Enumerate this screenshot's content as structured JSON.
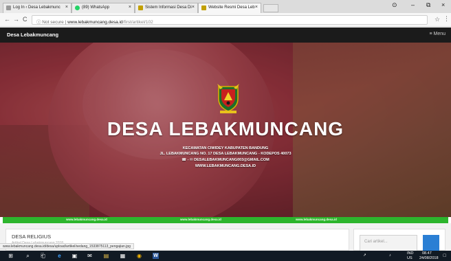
{
  "browser": {
    "tabs": [
      {
        "label": "Log In ‹ Desa Lebakmunc",
        "favicon_color": "#9a9a9a"
      },
      {
        "label": "(89) WhatsApp",
        "favicon_color": "#25d366"
      },
      {
        "label": "Sistem Informasi Desa Di",
        "favicon_color": "#c2a000"
      },
      {
        "label": "Website Resmi Desa Leb",
        "favicon_color": "#c2a000"
      }
    ],
    "close_glyph": "×",
    "window_controls": {
      "account": "⊙",
      "minimize": "–",
      "maximize": "⧉",
      "close": "×"
    },
    "nav": {
      "back": "←",
      "forward": "→",
      "reload": "C"
    },
    "address": {
      "secure_label": "ⓘ Not secure",
      "separator": " | ",
      "host": "www.lebakmuncang.desa.id",
      "path": "/first/artikel/102"
    },
    "star": "☆",
    "menu": "⋮"
  },
  "site": {
    "brand": "Desa Lebakmuncang",
    "menu_label": "≡ Menu",
    "hero": {
      "title": "DESA LEBAKMUNCANG",
      "lines": [
        "KECAMATAN CIWIDEY KABUPATEN BANDUNG",
        "JL. LEBAKMUNCANG NO. 17 DESA LEBAKMUNCANG - KODEPOS 40073",
        "☎ - ✉ DESALEBAKMUNCANG003@GMAIL.COM",
        "WWW.LEBAKMUNCANG.DESA.ID"
      ]
    },
    "banner": [
      "www.lebakmuncang.desa.id",
      "www.lebakmuncang.desa.id",
      "www.lebakmuncang.desa.id"
    ],
    "article": {
      "title": "DESA RELIGIUS",
      "subtitle": "Artikel Desa Lebakmuncang 2018"
    },
    "search": {
      "placeholder": "Cari artikel..."
    }
  },
  "status_url": "www.lebakmuncang.desa.id/desa/upload/artikel/sedang_1533875113_pengajian.jpg",
  "taskbar": {
    "icons": [
      {
        "name": "windows-start-icon",
        "glyph": "⊞"
      },
      {
        "name": "search-icon",
        "glyph": "⌕"
      },
      {
        "name": "task-view-icon",
        "glyph": "⎗"
      },
      {
        "name": "edge-icon",
        "glyph": "e"
      },
      {
        "name": "store-icon",
        "glyph": "▣"
      },
      {
        "name": "mail-icon",
        "glyph": "✉"
      },
      {
        "name": "explorer-icon",
        "glyph": "▤"
      },
      {
        "name": "photos-icon",
        "glyph": "▦"
      },
      {
        "name": "chrome-icon",
        "glyph": "◉"
      },
      {
        "name": "word-icon",
        "glyph": "W"
      }
    ],
    "tray": {
      "lang": "IND",
      "region": "US",
      "time": "08.47",
      "date": "24/08/2018"
    }
  },
  "colors": {
    "banner": "#2db52d",
    "navbar": "#1b1b1b",
    "search_button": "#2a7fd4"
  }
}
